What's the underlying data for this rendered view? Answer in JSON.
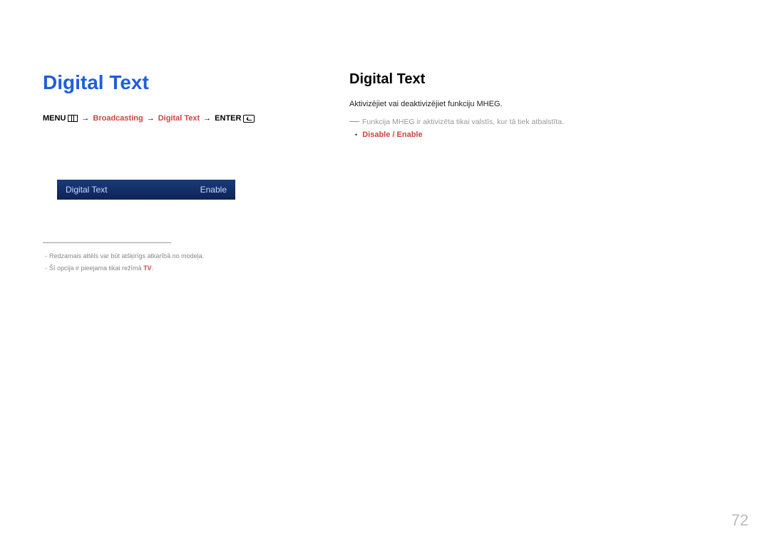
{
  "left": {
    "title": "Digital Text",
    "breadcrumb": {
      "menu": "MENU",
      "path1": "Broadcasting",
      "path2": "Digital Text",
      "enter": "ENTER"
    },
    "menu_item": {
      "label": "Digital Text",
      "value": "Enable"
    },
    "footnotes": {
      "f1": "Redzamais attēls var būt atšķirīgs atkarībā no modeļa.",
      "f2_prefix": "Šī opcija ir pieejama tikai režīmā ",
      "f2_tv": "TV"
    }
  },
  "right": {
    "title": "Digital Text",
    "line1": "Aktivizējiet vai deaktivizējiet funkciju MHEG.",
    "line2": "Funkcija MHEG ir aktivizēta tikai valstīs, kur tā tiek atbalstīta.",
    "opt_disable": "Disable",
    "opt_slash": " / ",
    "opt_enable": "Enable"
  },
  "page_number": "72"
}
